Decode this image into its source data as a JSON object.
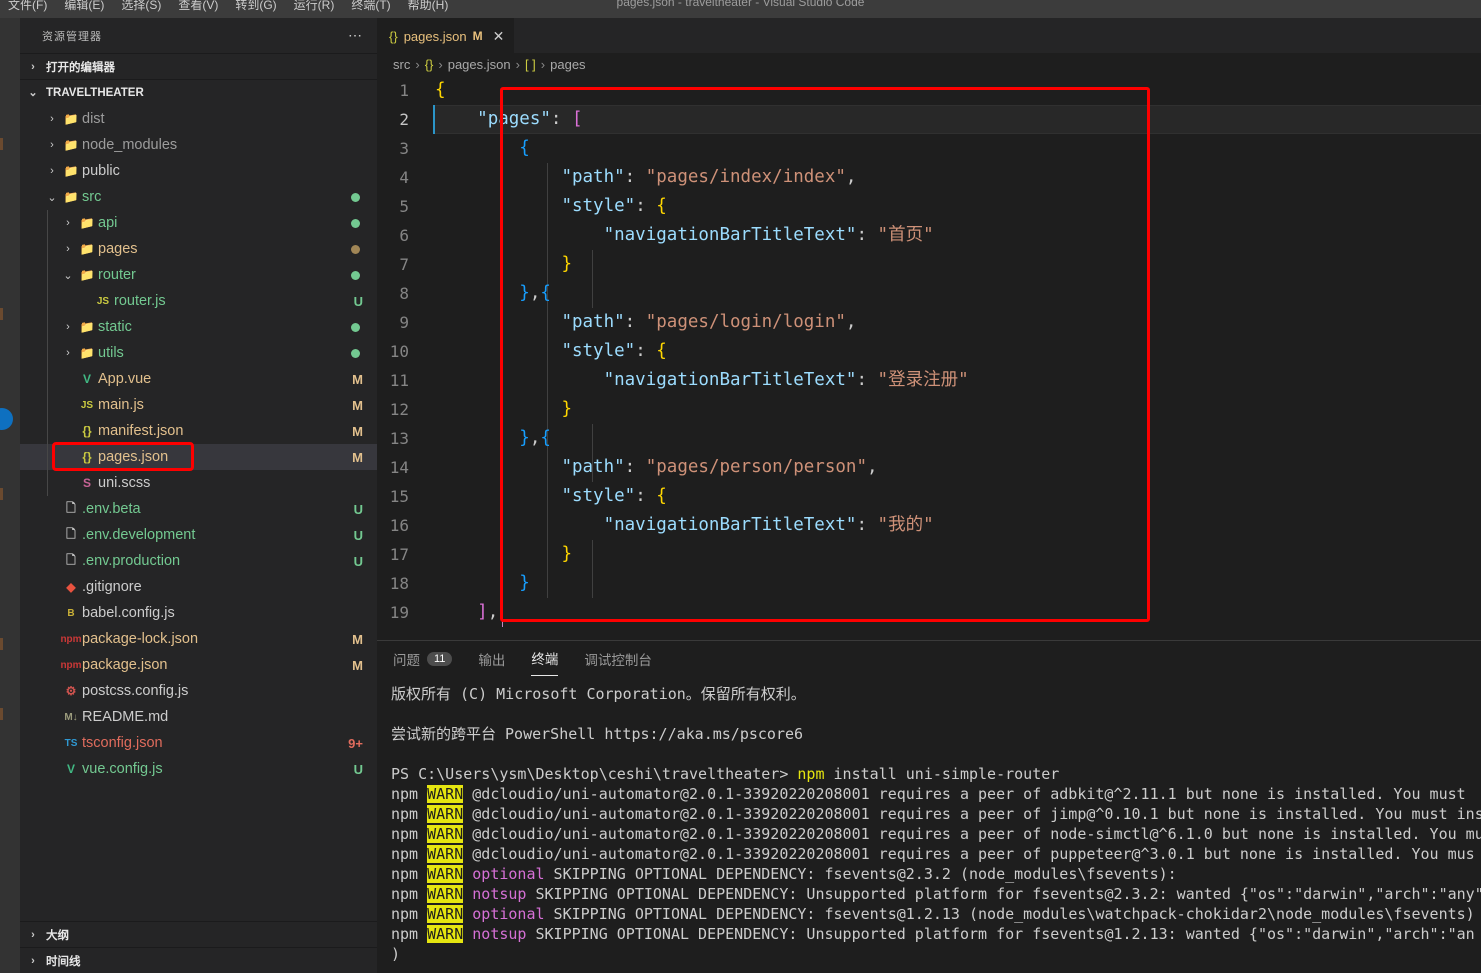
{
  "window": {
    "title": "pages.json - traveltheater - Visual Studio Code",
    "menu": [
      "文件(F)",
      "编辑(E)",
      "选择(S)",
      "查看(V)",
      "转到(G)",
      "运行(R)",
      "终端(T)",
      "帮助(H)"
    ]
  },
  "sidebar": {
    "header_title": "资源管理器",
    "dots": "⋯",
    "open_editors_label": "打开的编辑器",
    "project_label": "TRAVELTHEATER",
    "outline_label": "大纲",
    "timeline_label": "时间线",
    "tree": [
      {
        "name": "dist",
        "indent": 1,
        "icon": "📁",
        "icon_color": "#dcb67a",
        "chevron": "›",
        "text_color": "#9c9c9c",
        "badge": "",
        "dot": ""
      },
      {
        "name": "node_modules",
        "indent": 1,
        "icon": "📁",
        "icon_color": "#7fb241",
        "chevron": "›",
        "text_color": "#9c9c9c",
        "badge": "",
        "dot": ""
      },
      {
        "name": "public",
        "indent": 1,
        "icon": "📁",
        "icon_color": "#3fb950",
        "chevron": "›",
        "text_color": "#cccccc",
        "badge": "",
        "dot": ""
      },
      {
        "name": "src",
        "indent": 1,
        "icon": "📁",
        "icon_color": "#4ec9a0",
        "chevron": "⌄",
        "text_color": "#73c991",
        "badge": "",
        "dot": "#73c991"
      },
      {
        "name": "api",
        "indent": 2,
        "icon": "📁",
        "icon_color": "#8cc84b",
        "chevron": "›",
        "text_color": "#73c991",
        "badge": "",
        "dot": "#73c991"
      },
      {
        "name": "pages",
        "indent": 2,
        "icon": "📁",
        "icon_color": "#d1544f",
        "chevron": "›",
        "text_color": "#e2c08d",
        "badge": "",
        "dot": "#a18656"
      },
      {
        "name": "router",
        "indent": 2,
        "icon": "📁",
        "icon_color": "#dcb67a",
        "chevron": "⌄",
        "text_color": "#73c991",
        "badge": "",
        "dot": "#73c991"
      },
      {
        "name": "router.js",
        "indent": 3,
        "icon": "JS",
        "icon_color": "#cbcb41",
        "chevron": "",
        "text_color": "#73c991",
        "badge": "U",
        "badge_color": "#73c991",
        "dot": ""
      },
      {
        "name": "static",
        "indent": 2,
        "icon": "📁",
        "icon_color": "#dcb67a",
        "chevron": "›",
        "text_color": "#73c991",
        "badge": "",
        "dot": "#73c991"
      },
      {
        "name": "utils",
        "indent": 2,
        "icon": "📁",
        "icon_color": "#e8a33d",
        "chevron": "›",
        "text_color": "#73c991",
        "badge": "",
        "dot": "#73c991"
      },
      {
        "name": "App.vue",
        "indent": 2,
        "icon": "V",
        "icon_color": "#41b883",
        "chevron": "",
        "text_color": "#e2c08d",
        "badge": "M",
        "badge_color": "#e2c08d",
        "dot": ""
      },
      {
        "name": "main.js",
        "indent": 2,
        "icon": "JS",
        "icon_color": "#cbcb41",
        "chevron": "",
        "text_color": "#e2c08d",
        "badge": "M",
        "badge_color": "#e2c08d",
        "dot": ""
      },
      {
        "name": "manifest.json",
        "indent": 2,
        "icon": "{}",
        "icon_color": "#cbcb41",
        "chevron": "",
        "text_color": "#e2c08d",
        "badge": "M",
        "badge_color": "#e2c08d",
        "dot": ""
      },
      {
        "name": "pages.json",
        "indent": 2,
        "icon": "{}",
        "icon_color": "#cbcb41",
        "chevron": "",
        "text_color": "#e2c08d",
        "badge": "M",
        "badge_color": "#e2c08d",
        "dot": "",
        "selected": true,
        "highlight": true
      },
      {
        "name": "uni.scss",
        "indent": 2,
        "icon": "S",
        "icon_color": "#c76395",
        "chevron": "",
        "text_color": "#cccccc",
        "badge": "",
        "dot": ""
      },
      {
        "name": ".env.beta",
        "indent": 1,
        "icon": "🗋",
        "icon_color": "#c5c5c5",
        "chevron": "",
        "text_color": "#73c991",
        "badge": "U",
        "badge_color": "#73c991",
        "dot": ""
      },
      {
        "name": ".env.development",
        "indent": 1,
        "icon": "🗋",
        "icon_color": "#c5c5c5",
        "chevron": "",
        "text_color": "#73c991",
        "badge": "U",
        "badge_color": "#73c991",
        "dot": ""
      },
      {
        "name": ".env.production",
        "indent": 1,
        "icon": "🗋",
        "icon_color": "#c5c5c5",
        "chevron": "",
        "text_color": "#73c991",
        "badge": "U",
        "badge_color": "#73c991",
        "dot": ""
      },
      {
        "name": ".gitignore",
        "indent": 1,
        "icon": "◆",
        "icon_color": "#e8523f",
        "chevron": "",
        "text_color": "#cccccc",
        "badge": "",
        "dot": ""
      },
      {
        "name": "babel.config.js",
        "indent": 1,
        "icon": "B",
        "icon_color": "#c9b037",
        "chevron": "",
        "text_color": "#cccccc",
        "badge": "",
        "dot": ""
      },
      {
        "name": "package-lock.json",
        "indent": 1,
        "icon": "npm",
        "icon_color": "#cb3837",
        "chevron": "",
        "text_color": "#e2c08d",
        "badge": "M",
        "badge_color": "#e2c08d",
        "dot": ""
      },
      {
        "name": "package.json",
        "indent": 1,
        "icon": "npm",
        "icon_color": "#cb3837",
        "chevron": "",
        "text_color": "#e2c08d",
        "badge": "M",
        "badge_color": "#e2c08d",
        "dot": ""
      },
      {
        "name": "postcss.config.js",
        "indent": 1,
        "icon": "⚙",
        "icon_color": "#d1544f",
        "chevron": "",
        "text_color": "#cccccc",
        "badge": "",
        "dot": ""
      },
      {
        "name": "README.md",
        "indent": 1,
        "icon": "M↓",
        "icon_color": "#9c9c7d",
        "chevron": "",
        "text_color": "#cccccc",
        "badge": "",
        "dot": ""
      },
      {
        "name": "tsconfig.json",
        "indent": 1,
        "icon": "TS",
        "icon_color": "#2f99d3",
        "chevron": "",
        "text_color": "#e06c5d",
        "badge": "9+",
        "badge_color": "#e06c5d",
        "dot": ""
      },
      {
        "name": "vue.config.js",
        "indent": 1,
        "icon": "V",
        "icon_color": "#41b883",
        "chevron": "",
        "text_color": "#73c991",
        "badge": "U",
        "badge_color": "#73c991",
        "dot": ""
      }
    ]
  },
  "editor": {
    "tab": {
      "icon": "{}",
      "label": "pages.json",
      "dirty": "M",
      "close": "✕"
    },
    "breadcrumb": [
      {
        "text": "src",
        "kind": "plain"
      },
      {
        "text": "{}",
        "kind": "json"
      },
      {
        "text": "pages.json",
        "kind": "plain"
      },
      {
        "text": "[ ]",
        "kind": "array"
      },
      {
        "text": "pages",
        "kind": "plain"
      }
    ],
    "breadcrumb_sep": "›",
    "lines": [
      {
        "n": "1",
        "segs": [
          {
            "t": "{",
            "c": "br1"
          }
        ]
      },
      {
        "n": "2",
        "current": true,
        "segs": [
          {
            "t": "    ",
            "c": "pun"
          },
          {
            "t": "\"pages\"",
            "c": "kw"
          },
          {
            "t": ": ",
            "c": "pun"
          },
          {
            "t": "[",
            "c": "br2"
          }
        ]
      },
      {
        "n": "3",
        "segs": [
          {
            "t": "        ",
            "c": "pun"
          },
          {
            "t": "{",
            "c": "br3"
          }
        ]
      },
      {
        "n": "4",
        "segs": [
          {
            "t": "            ",
            "c": "pun"
          },
          {
            "t": "\"path\"",
            "c": "kw"
          },
          {
            "t": ": ",
            "c": "pun"
          },
          {
            "t": "\"pages/index/index\"",
            "c": "str"
          },
          {
            "t": ",",
            "c": "pun"
          }
        ]
      },
      {
        "n": "5",
        "segs": [
          {
            "t": "            ",
            "c": "pun"
          },
          {
            "t": "\"style\"",
            "c": "kw"
          },
          {
            "t": ": ",
            "c": "pun"
          },
          {
            "t": "{",
            "c": "br1"
          }
        ]
      },
      {
        "n": "6",
        "segs": [
          {
            "t": "                ",
            "c": "pun"
          },
          {
            "t": "\"navigationBarTitleText\"",
            "c": "kw"
          },
          {
            "t": ": ",
            "c": "pun"
          },
          {
            "t": "\"首页\"",
            "c": "str"
          }
        ]
      },
      {
        "n": "7",
        "segs": [
          {
            "t": "            ",
            "c": "pun"
          },
          {
            "t": "}",
            "c": "br1"
          }
        ]
      },
      {
        "n": "8",
        "segs": [
          {
            "t": "        ",
            "c": "pun"
          },
          {
            "t": "}",
            "c": "br3"
          },
          {
            "t": ",",
            "c": "pun"
          },
          {
            "t": "{",
            "c": "br3"
          }
        ]
      },
      {
        "n": "9",
        "segs": [
          {
            "t": "            ",
            "c": "pun"
          },
          {
            "t": "\"path\"",
            "c": "kw"
          },
          {
            "t": ": ",
            "c": "pun"
          },
          {
            "t": "\"pages/login/login\"",
            "c": "str"
          },
          {
            "t": ",",
            "c": "pun"
          }
        ]
      },
      {
        "n": "10",
        "segs": [
          {
            "t": "            ",
            "c": "pun"
          },
          {
            "t": "\"style\"",
            "c": "kw"
          },
          {
            "t": ": ",
            "c": "pun"
          },
          {
            "t": "{",
            "c": "br1"
          }
        ]
      },
      {
        "n": "11",
        "segs": [
          {
            "t": "                ",
            "c": "pun"
          },
          {
            "t": "\"navigationBarTitleText\"",
            "c": "kw"
          },
          {
            "t": ": ",
            "c": "pun"
          },
          {
            "t": "\"登录注册\"",
            "c": "str"
          }
        ]
      },
      {
        "n": "12",
        "segs": [
          {
            "t": "            ",
            "c": "pun"
          },
          {
            "t": "}",
            "c": "br1"
          }
        ]
      },
      {
        "n": "13",
        "segs": [
          {
            "t": "        ",
            "c": "pun"
          },
          {
            "t": "}",
            "c": "br3"
          },
          {
            "t": ",",
            "c": "pun"
          },
          {
            "t": "{",
            "c": "br3"
          }
        ]
      },
      {
        "n": "14",
        "segs": [
          {
            "t": "            ",
            "c": "pun"
          },
          {
            "t": "\"path\"",
            "c": "kw"
          },
          {
            "t": ": ",
            "c": "pun"
          },
          {
            "t": "\"pages/person/person\"",
            "c": "str"
          },
          {
            "t": ",",
            "c": "pun"
          }
        ]
      },
      {
        "n": "15",
        "segs": [
          {
            "t": "            ",
            "c": "pun"
          },
          {
            "t": "\"style\"",
            "c": "kw"
          },
          {
            "t": ": ",
            "c": "pun"
          },
          {
            "t": "{",
            "c": "br1"
          }
        ]
      },
      {
        "n": "16",
        "segs": [
          {
            "t": "                ",
            "c": "pun"
          },
          {
            "t": "\"navigationBarTitleText\"",
            "c": "kw"
          },
          {
            "t": ": ",
            "c": "pun"
          },
          {
            "t": "\"我的\"",
            "c": "str"
          }
        ]
      },
      {
        "n": "17",
        "segs": [
          {
            "t": "            ",
            "c": "pun"
          },
          {
            "t": "}",
            "c": "br1"
          }
        ]
      },
      {
        "n": "18",
        "segs": [
          {
            "t": "        ",
            "c": "pun"
          },
          {
            "t": "}",
            "c": "br3"
          }
        ]
      },
      {
        "n": "19",
        "segs": [
          {
            "t": "    ",
            "c": "pun"
          },
          {
            "t": "]",
            "c": "br2"
          },
          {
            "t": ",",
            "c": "pun"
          }
        ]
      }
    ]
  },
  "panel": {
    "tabs": [
      {
        "label": "问题",
        "badge": "11",
        "active": false
      },
      {
        "label": "输出",
        "badge": "",
        "active": false
      },
      {
        "label": "终端",
        "badge": "",
        "active": true
      },
      {
        "label": "调试控制台",
        "badge": "",
        "active": false
      }
    ],
    "terminal": [
      {
        "segs": [
          {
            "t": "版权所有 (C) Microsoft Corporation。保留所有权利。",
            "c": ""
          }
        ]
      },
      {
        "segs": [
          {
            "t": "",
            "c": ""
          }
        ]
      },
      {
        "segs": [
          {
            "t": "尝试新的跨平台 PowerShell https://aka.ms/pscore6",
            "c": ""
          }
        ]
      },
      {
        "segs": [
          {
            "t": "",
            "c": ""
          }
        ]
      },
      {
        "segs": [
          {
            "t": "PS C:\\Users\\ysm\\Desktop\\ceshi\\traveltheater> ",
            "c": ""
          },
          {
            "t": "npm",
            "c": "yel"
          },
          {
            "t": " install uni-simple-router",
            "c": ""
          }
        ]
      },
      {
        "segs": [
          {
            "t": "npm ",
            "c": ""
          },
          {
            "t": "WARN",
            "c": "warn"
          },
          {
            "t": " @dcloudio/uni-automator@2.0.1-33920220208001 requires a peer of adbkit@^2.11.1 but none is installed. You must ",
            "c": ""
          }
        ]
      },
      {
        "segs": [
          {
            "t": "npm ",
            "c": ""
          },
          {
            "t": "WARN",
            "c": "warn"
          },
          {
            "t": " @dcloudio/uni-automator@2.0.1-33920220208001 requires a peer of jimp@^0.10.1 but none is installed. You must ins",
            "c": ""
          }
        ]
      },
      {
        "segs": [
          {
            "t": "npm ",
            "c": ""
          },
          {
            "t": "WARN",
            "c": "warn"
          },
          {
            "t": " @dcloudio/uni-automator@2.0.1-33920220208001 requires a peer of node-simctl@^6.1.0 but none is installed. You mu",
            "c": ""
          }
        ]
      },
      {
        "segs": [
          {
            "t": "npm ",
            "c": ""
          },
          {
            "t": "WARN",
            "c": "warn"
          },
          {
            "t": " @dcloudio/uni-automator@2.0.1-33920220208001 requires a peer of puppeteer@^3.0.1 but none is installed. You mus",
            "c": ""
          }
        ]
      },
      {
        "segs": [
          {
            "t": "npm ",
            "c": ""
          },
          {
            "t": "WARN",
            "c": "warn"
          },
          {
            "t": " ",
            "c": ""
          },
          {
            "t": "optional",
            "c": "mag"
          },
          {
            "t": " SKIPPING OPTIONAL DEPENDENCY: fsevents@2.3.2 (node_modules\\fsevents):",
            "c": ""
          }
        ]
      },
      {
        "segs": [
          {
            "t": "npm ",
            "c": ""
          },
          {
            "t": "WARN",
            "c": "warn"
          },
          {
            "t": " ",
            "c": ""
          },
          {
            "t": "notsup",
            "c": "mag"
          },
          {
            "t": " SKIPPING OPTIONAL DEPENDENCY: Unsupported platform for fsevents@2.3.2: wanted {\"os\":\"darwin\",\"arch\":\"any\"",
            "c": ""
          }
        ]
      },
      {
        "segs": [
          {
            "t": "npm ",
            "c": ""
          },
          {
            "t": "WARN",
            "c": "warn"
          },
          {
            "t": " ",
            "c": ""
          },
          {
            "t": "optional",
            "c": "mag"
          },
          {
            "t": " SKIPPING OPTIONAL DEPENDENCY: fsevents@1.2.13 (node_modules\\watchpack-chokidar2\\node_modules\\fsevents)",
            "c": ""
          }
        ]
      },
      {
        "segs": [
          {
            "t": "npm ",
            "c": ""
          },
          {
            "t": "WARN",
            "c": "warn"
          },
          {
            "t": " ",
            "c": ""
          },
          {
            "t": "notsup",
            "c": "mag"
          },
          {
            "t": " SKIPPING OPTIONAL DEPENDENCY: Unsupported platform for fsevents@1.2.13: wanted {\"os\":\"darwin\",\"arch\":\"an",
            "c": ""
          }
        ]
      },
      {
        "segs": [
          {
            "t": ")",
            "c": ""
          }
        ]
      }
    ]
  },
  "colors": {
    "highlight_red": "#fe0000",
    "accent_blue": "#0e70c0",
    "editor_bg": "#1e1e1e",
    "sidebar_bg": "#252526"
  }
}
